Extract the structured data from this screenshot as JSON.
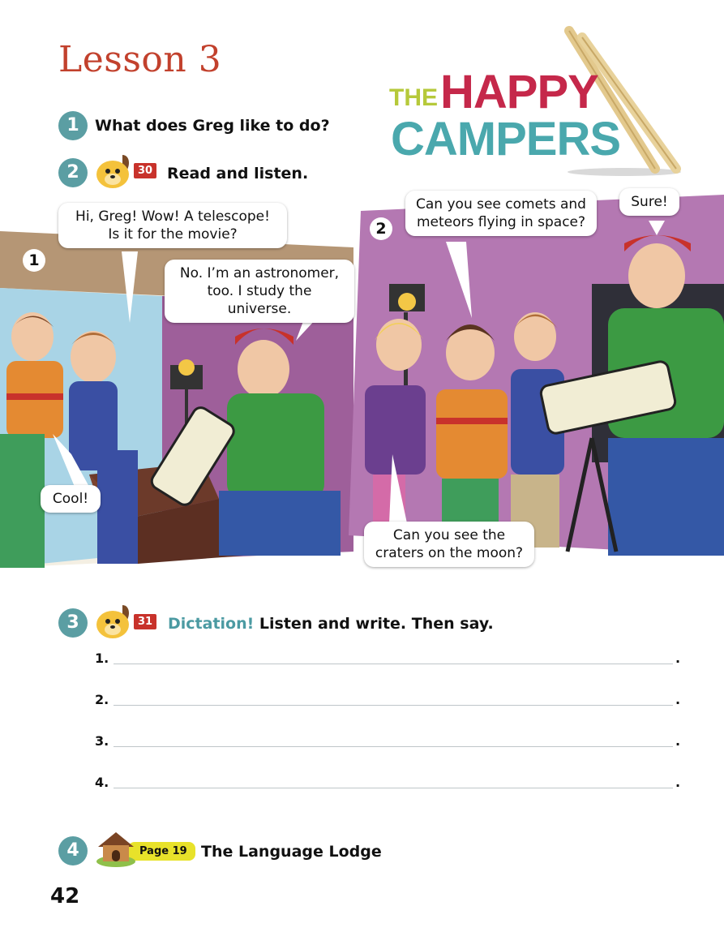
{
  "lesson": {
    "title": "Lesson 3"
  },
  "logo": {
    "the": "THE",
    "happy": "HAPPY",
    "campers": "CAMPERS"
  },
  "exercises": [
    {
      "number": "1",
      "text": "What does Greg like to do?"
    },
    {
      "number": "2",
      "track": "30",
      "text": "Read and listen."
    },
    {
      "number": "3",
      "track": "31",
      "highlight": "Dictation!",
      "text": "Listen and write. Then say."
    },
    {
      "number": "4",
      "page_ref": "Page 19",
      "text": "The Language Lodge"
    }
  ],
  "comic": {
    "panel1": {
      "number": "1",
      "bubbles": [
        {
          "line1": "Hi, Greg! Wow! A telescope!",
          "line2": "Is it for the movie?"
        },
        {
          "line1": "No. I’m an astronomer,",
          "line2": "too. I study the universe."
        },
        {
          "line1": "Cool!"
        }
      ]
    },
    "panel2": {
      "number": "2",
      "bubbles": [
        {
          "line1": "Can you see comets and",
          "line2": "meteors flying in space?"
        },
        {
          "line1": "Sure!"
        },
        {
          "line1": "Can you see the",
          "line2": "craters on the moon?"
        }
      ]
    }
  },
  "dictation_lines": [
    {
      "label": "1.",
      "end": "."
    },
    {
      "label": "2.",
      "end": "."
    },
    {
      "label": "3.",
      "end": "."
    },
    {
      "label": "4.",
      "end": "."
    }
  ],
  "page_number": "42",
  "colors": {
    "title": "#c2412d",
    "circle": "#5b9ea3",
    "badge": "#c8322b",
    "page_badge": "#e8e22a"
  },
  "icons": [
    "dog-mascot-icon",
    "lodge-house-icon",
    "drumsticks-icon"
  ]
}
